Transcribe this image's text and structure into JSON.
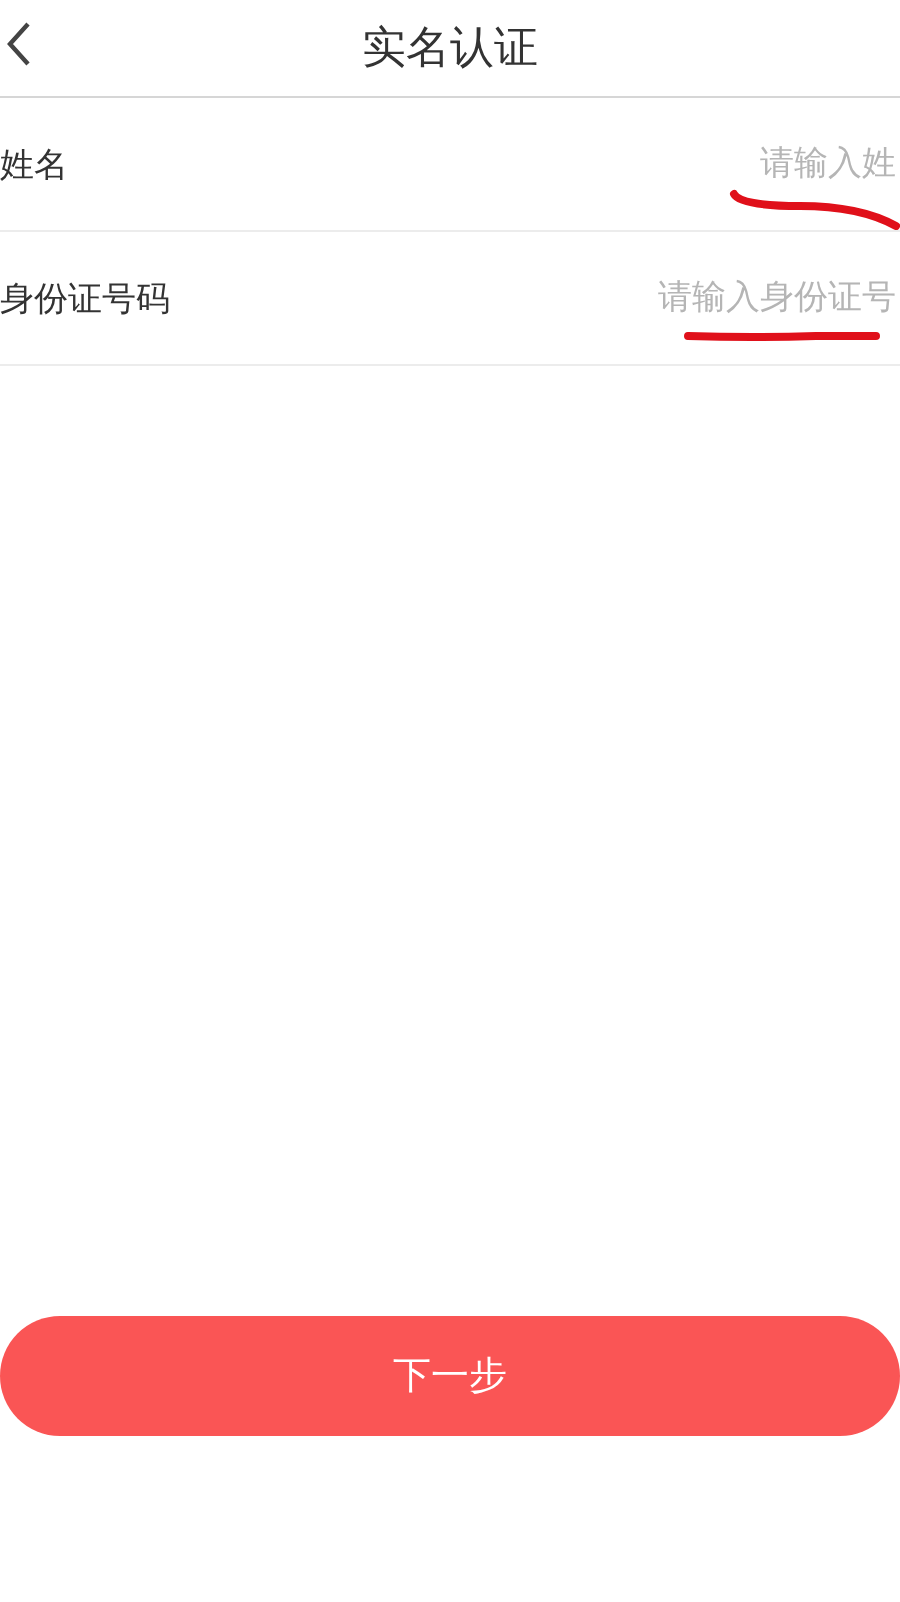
{
  "header": {
    "title": "实名认证"
  },
  "fields": [
    {
      "label": "姓名",
      "placeholder": "请输入姓"
    },
    {
      "label": "身份证号码",
      "placeholder": "请输入身份证号"
    }
  ],
  "button": {
    "label": "下一步"
  }
}
